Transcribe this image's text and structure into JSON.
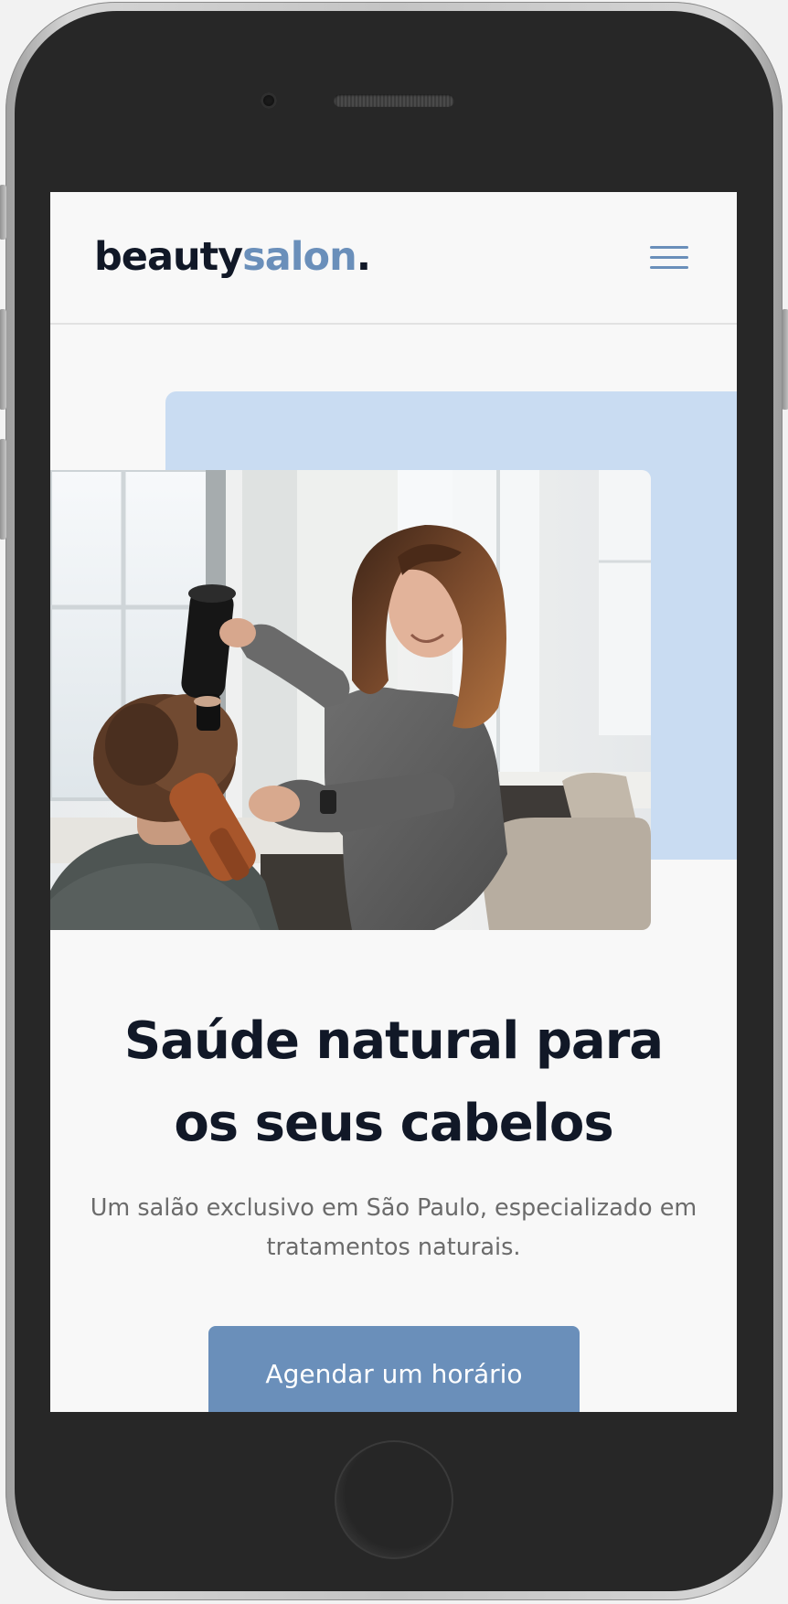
{
  "header": {
    "logo_main": "beauty",
    "logo_accent": "salon",
    "logo_dot": "."
  },
  "hero": {
    "headline_line1": "Saúde natural para",
    "headline_line2": "os seus cabelos",
    "subtitle": "Um salão exclusivo em São Paulo, especializado em tratamentos naturais.",
    "cta_label": "Agendar um horário"
  },
  "colors": {
    "accent": "#6a8fba",
    "accent_light": "#c9dcf2",
    "text_dark": "#111827",
    "text_muted": "#6b6b6b",
    "background": "#f8f8f8"
  },
  "icons": {
    "menu": "hamburger-menu-icon"
  }
}
